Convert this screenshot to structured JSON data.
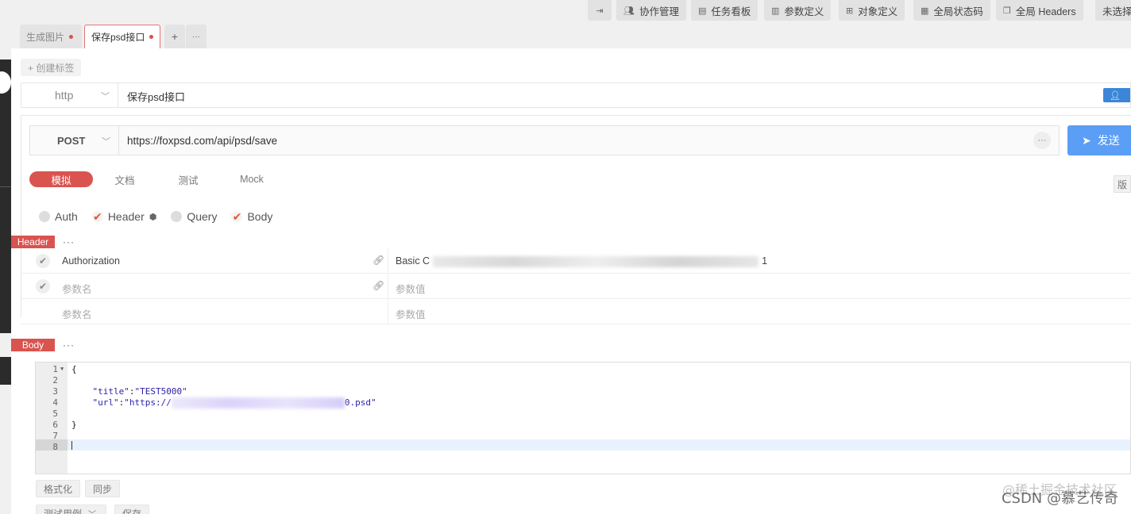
{
  "toolbar": {
    "items": [
      {
        "label": "",
        "icon": "collapse-icon"
      },
      {
        "label": "协作管理",
        "icon": "team-icon"
      },
      {
        "label": "任务看板",
        "icon": "board-icon"
      },
      {
        "label": "参数定义",
        "icon": "doc-icon"
      },
      {
        "label": "对象定义",
        "icon": "grid-icon"
      },
      {
        "label": "全局状态码",
        "icon": "code-icon"
      },
      {
        "label": "全局 Headers",
        "icon": "layers-icon"
      },
      {
        "label": "未选择",
        "icon": ""
      }
    ]
  },
  "tabs": [
    {
      "label": "生成图片",
      "active": false,
      "unsaved": true
    },
    {
      "label": "保存psd接口",
      "active": true,
      "unsaved": true
    }
  ],
  "tab_actions": {
    "add": "+",
    "more": "···"
  },
  "create_tag": "+ 创建标签",
  "api": {
    "protocol": "http",
    "name": "保存psd接口",
    "method": "POST",
    "url": "https://foxpsd.com/api/psd/save",
    "url_more": "···",
    "send_label": "发送",
    "version_label": "版"
  },
  "subtabs": [
    "模拟",
    "文档",
    "测试",
    "Mock"
  ],
  "options": [
    {
      "label": "Auth",
      "checked": false
    },
    {
      "label": "Header",
      "checked": true
    },
    {
      "label": "Query",
      "checked": false
    },
    {
      "label": "Body",
      "checked": true
    }
  ],
  "header_section": {
    "label": "Header",
    "more": "···",
    "rows": [
      {
        "key": "Authorization",
        "value_start": "Basic C",
        "value_end": "1",
        "placeholder": false
      },
      {
        "key": "参数名",
        "value": "参数值",
        "placeholder": true
      },
      {
        "key": "参数名",
        "value": "参数值",
        "placeholder": true
      }
    ]
  },
  "body_section": {
    "label": "Body",
    "more": "···",
    "lines": [
      {
        "n": "1",
        "text": "{"
      },
      {
        "n": "2",
        "text": ""
      },
      {
        "n": "3",
        "key": "\"title\"",
        "val": "\"TEST5000\""
      },
      {
        "n": "4",
        "key": "\"url\"",
        "val_start": "\"https://",
        "val_end": "0.psd\""
      },
      {
        "n": "5",
        "text": ""
      },
      {
        "n": "6",
        "text": "}"
      },
      {
        "n": "7",
        "text": ""
      },
      {
        "n": "8",
        "text": ""
      }
    ]
  },
  "editor_buttons": {
    "format": "格式化",
    "sync": "同步",
    "test_case": "测试用例",
    "save": "保存"
  },
  "watermark": {
    "line1": "@稀土掘金技术社区",
    "line2": "CSDN @慕艺传奇"
  }
}
